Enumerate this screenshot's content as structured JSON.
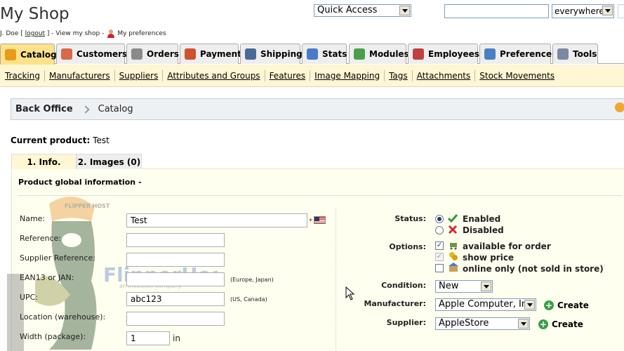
{
  "header": {
    "shop_title": "My Shop",
    "quick_access": "Quick Access",
    "search_value": "",
    "search_scope": "everywhere",
    "user": "J. Doe",
    "logout": "logout",
    "view_shop": "View my shop",
    "preferences": "My preferences"
  },
  "tabs": [
    {
      "label": "Catalog",
      "color": "#e89b1a"
    },
    {
      "label": "Customers",
      "color": "#d46a4a"
    },
    {
      "label": "Orders",
      "color": "#8a8a8a"
    },
    {
      "label": "Payment",
      "color": "#d05030"
    },
    {
      "label": "Shipping",
      "color": "#4a6a9a"
    },
    {
      "label": "Stats",
      "color": "#4a7ac8"
    },
    {
      "label": "Modules",
      "color": "#4aa04a"
    },
    {
      "label": "Employees",
      "color": "#c04040"
    },
    {
      "label": "Preferences",
      "color": "#4a80c0"
    },
    {
      "label": "Tools",
      "color": "#7a8aa0"
    }
  ],
  "submenu": [
    "Tracking",
    "Manufacturers",
    "Suppliers",
    "Attributes and Groups",
    "Features",
    "Image Mapping",
    "Tags",
    "Attachments",
    "Stock Movements"
  ],
  "breadcrumb": {
    "home": "Back Office",
    "current": "Catalog"
  },
  "product": {
    "label": "Current product:",
    "name": "Test"
  },
  "product_tabs": [
    "1. Info.",
    "2. Images (0)"
  ],
  "panel_heading": "Product global information -",
  "watermark": {
    "brand": "FlipperHost",
    "tagline": "an investion company",
    "cap_text": "FLIPPER HOST"
  },
  "form_left": {
    "name_label": "Name:",
    "name_value": "Test",
    "required_mark": "*",
    "reference_label": "Reference:",
    "reference_value": "",
    "supplier_ref_label": "Supplier Reference:",
    "supplier_ref_value": "",
    "ean_label": "EAN13 or JAN:",
    "ean_value": "",
    "ean_hint": "(Europe, Japan)",
    "upc_label": "UPC:",
    "upc_value": "abc123",
    "upc_hint": "(US, Canada)",
    "location_label": "Location (warehouse):",
    "location_value": "",
    "width_label": "Width (package):",
    "width_value": "1",
    "width_unit": "in"
  },
  "form_right": {
    "status_label": "Status:",
    "enabled": "Enabled",
    "disabled": "Disabled",
    "options_label": "Options:",
    "available_for_order": "available for order",
    "show_price": "show price",
    "online_only": "online only (not sold in store)",
    "condition_label": "Condition:",
    "condition_value": "New",
    "manufacturer_label": "Manufacturer:",
    "manufacturer_value": "Apple Computer, Inc",
    "supplier_label": "Supplier:",
    "supplier_value": "AppleStore",
    "create": "Create"
  }
}
